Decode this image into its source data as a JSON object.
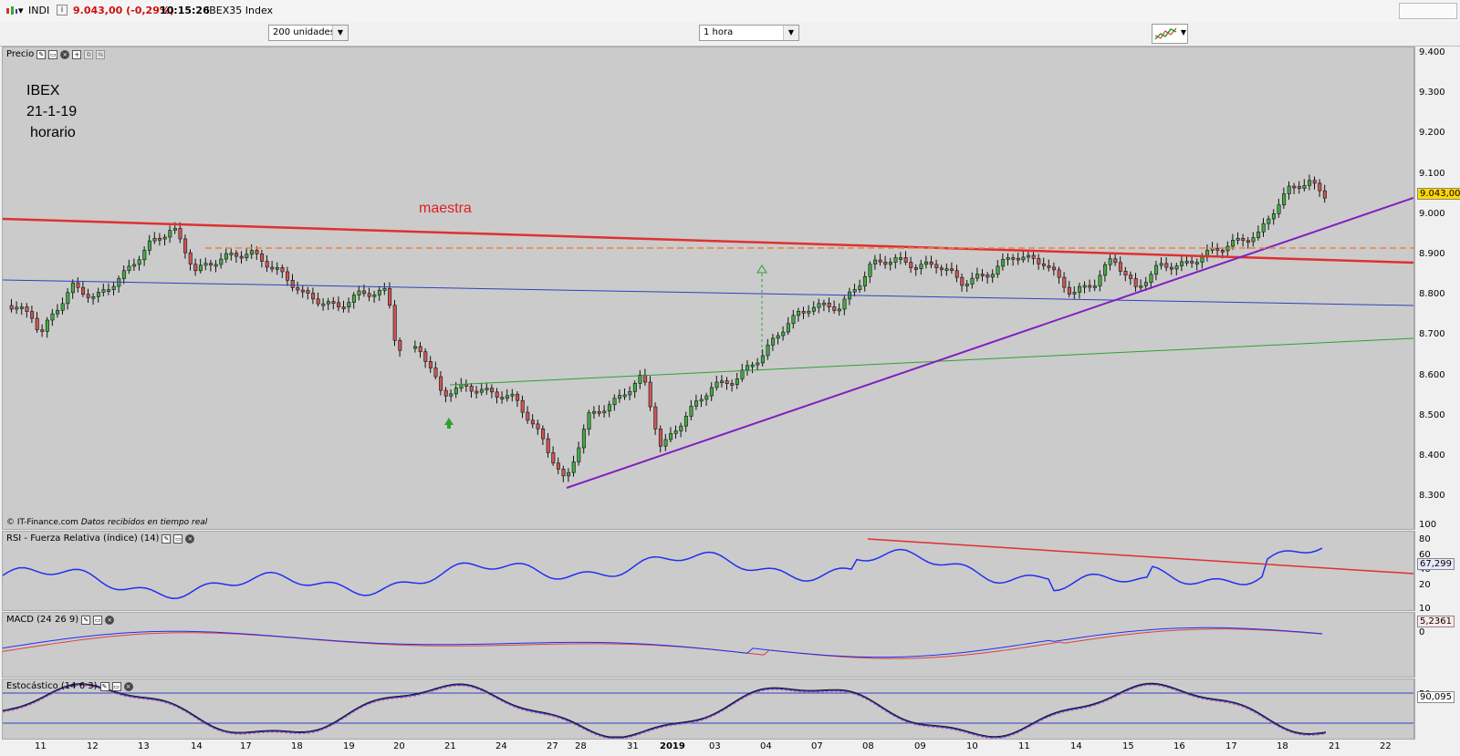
{
  "window": {
    "symbol": "INDI",
    "price": "9.043,00 (-0,29%)",
    "time": "10:15:26",
    "index_name": "IBEX35 Index"
  },
  "toolbar": {
    "units": "200 unidades",
    "interval": "1 hora"
  },
  "panels": {
    "price": {
      "label": "Precio",
      "annotation_lines": [
        "IBEX",
        "21-1-19",
        "horario"
      ],
      "maestra_label": "maestra",
      "footer_source": "© IT-Finance.com",
      "footer_note": "Datos recibidos en tiempo real",
      "current_value": "9.043,00",
      "y_ticks": [
        "9.400",
        "9.300",
        "9.200",
        "9.100",
        "9.000",
        "8.900",
        "8.800",
        "8.700",
        "8.600",
        "8.500",
        "8.400",
        "8.300"
      ]
    },
    "rsi": {
      "label": "RSI - Fuerza Relativa (índice) (14)",
      "current_value": "67,299",
      "y_ticks": [
        "100",
        "80",
        "60",
        "40",
        "20"
      ]
    },
    "macd": {
      "label": "MACD (24 26 9)",
      "current_value": "5,2361",
      "y_ticks": [
        "10",
        "0"
      ]
    },
    "stoch": {
      "label": "Estocástico (14 6 3)",
      "current_value": "90,095",
      "y_ticks": [
        "50"
      ]
    }
  },
  "x_axis": {
    "labels": [
      "11",
      "12",
      "13",
      "14",
      "17",
      "18",
      "19",
      "20",
      "21",
      "24",
      "27",
      "28",
      "31",
      "2019",
      "03",
      "04",
      "07",
      "08",
      "09",
      "10",
      "11",
      "14",
      "15",
      "16",
      "17",
      "18",
      "21",
      "22"
    ]
  },
  "colors": {
    "panel_bg": "#cbcbcb",
    "up_candle": "#44aa44",
    "down_candle": "#cc5555",
    "maestra_line": "#e03030",
    "support_purple": "#8020c0",
    "blue_line": "#3040c0",
    "green_line": "#30a030",
    "orange_dashed": "#f08040"
  },
  "icons": [
    "settings-wrench-icon",
    "maximize-icon",
    "close-icon",
    "add-panel-icon",
    "chart-type-icon"
  ]
}
